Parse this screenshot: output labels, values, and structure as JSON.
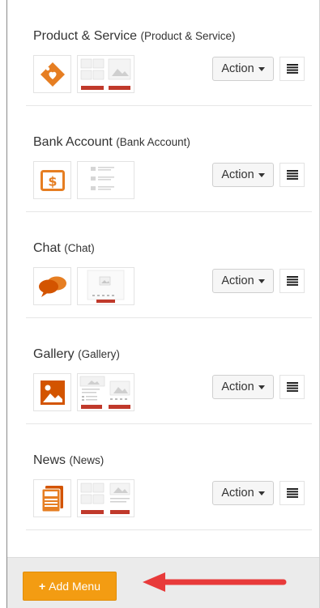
{
  "menus": [
    {
      "name": "Product & Service",
      "sub": "(Product & Service)",
      "icon": "tag-heart-icon",
      "thumb": "product-thumbnail",
      "action": "Action"
    },
    {
      "name": "Bank Account",
      "sub": "(Bank Account)",
      "icon": "bank-dollar-icon",
      "thumb": "bank-thumbnail",
      "action": "Action"
    },
    {
      "name": "Chat",
      "sub": "(Chat)",
      "icon": "chat-bubbles-icon",
      "thumb": "chat-thumbnail",
      "action": "Action"
    },
    {
      "name": "Gallery",
      "sub": "(Gallery)",
      "icon": "image-icon",
      "thumb": "gallery-thumbnail",
      "action": "Action"
    },
    {
      "name": "News",
      "sub": "(News)",
      "icon": "newspaper-icon",
      "thumb": "news-thumbnail",
      "action": "Action"
    }
  ],
  "footer": {
    "add_label": "Add Menu"
  },
  "colors": {
    "accent": "#f39c12",
    "icon_orange": "#e67e22",
    "arrow_red": "#e83a3a",
    "thumb_red": "#c0392b"
  }
}
